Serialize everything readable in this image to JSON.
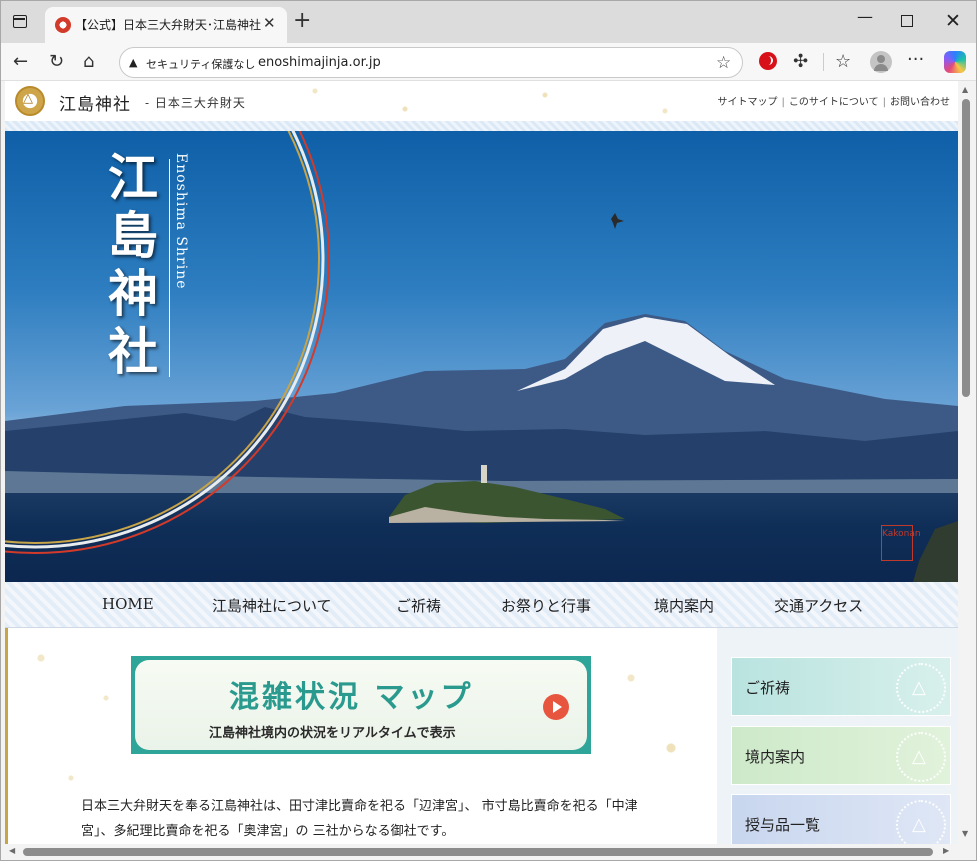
{
  "browser": {
    "tab_title": "【公式】日本三大弁財天･江島神社",
    "security_label": "セキュリティ保護なし",
    "url": "enoshimajinja.or.jp"
  },
  "site": {
    "name": "江島神社",
    "tagline": "- 日本三大弁財天",
    "util_links": [
      "サイトマップ",
      "このサイトについて",
      "お問い合わせ"
    ]
  },
  "hero": {
    "title_chars": [
      "江",
      "島",
      "神",
      "社"
    ],
    "subtitle_en": "Enoshima Shrine",
    "stamp_text": "Kakonan"
  },
  "nav": {
    "items": [
      "HOME",
      "江島神社について",
      "ご祈祷",
      "お祭りと行事",
      "境内案内",
      "交通アクセス"
    ]
  },
  "banner": {
    "title": "混雑状況 マップ",
    "subtitle": "江島神社境内の状況をリアルタイムで表示"
  },
  "intro": {
    "text": "日本三大弁財天を奉る江島神社は、田寸津比賣命を祀る「辺津宮」、 市寸島比賣命を祀る「中津宮」、多紀理比賣命を祀る「奥津宮」の 三社からなる御社です。"
  },
  "sidebar": {
    "cards": [
      "ご祈祷",
      "境内案内",
      "授与品一覧"
    ]
  }
}
